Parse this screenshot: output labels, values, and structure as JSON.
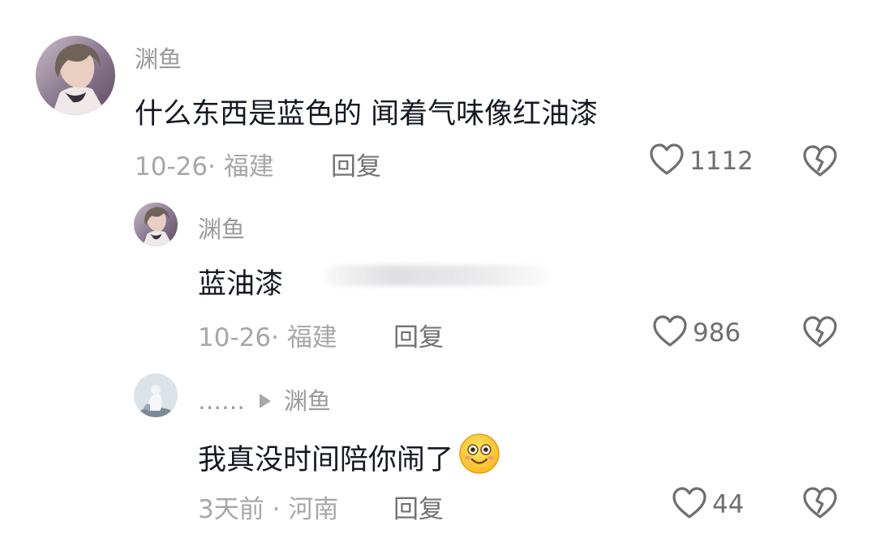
{
  "comments": [
    {
      "username": "渊鱼",
      "text": "什么东西是蓝色的 闻着气味像红油漆",
      "date": "10-26",
      "location": "福建",
      "reply_label": "回复",
      "likes": "1112"
    },
    {
      "username": "渊鱼",
      "text": "蓝油漆",
      "date": "10-26",
      "location": "福建",
      "reply_label": "回复",
      "likes": "986"
    },
    {
      "username": "……",
      "reply_to": "渊鱼",
      "text": "我真没时间陪你闹了",
      "date": "3天前",
      "location": "河南",
      "reply_label": "回复",
      "likes": "44"
    }
  ],
  "separator": "·",
  "icons": {
    "like": "heart-outline-icon",
    "dislike": "broken-heart-icon",
    "emoji": "grinning-emoji-icon",
    "reply_arrow": "play-arrow-icon"
  },
  "colors": {
    "text": "#161823",
    "meta": "#a6a6ab",
    "username": "#9a9a9f"
  }
}
